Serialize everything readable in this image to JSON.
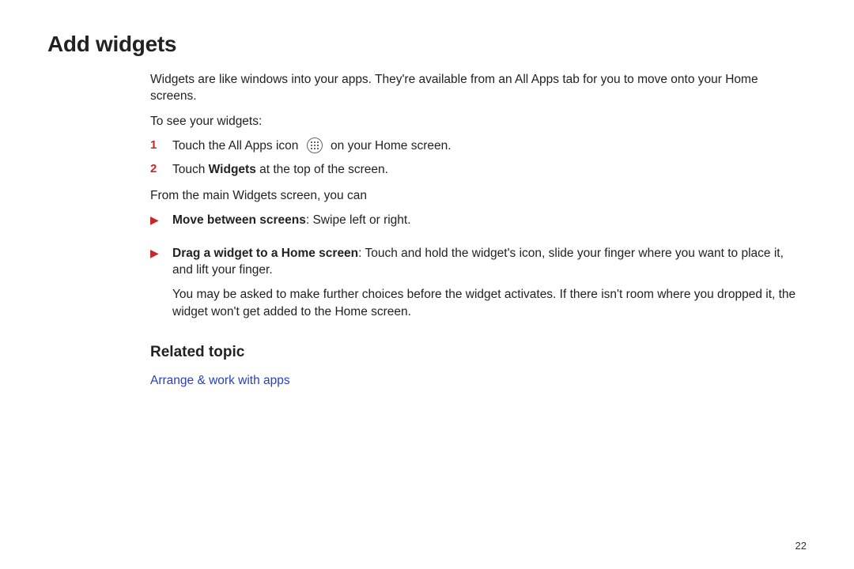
{
  "title": "Add widgets",
  "intro": "Widgets are like windows into your apps. They're available from an All Apps tab for you to move onto your Home screens.",
  "to_see_lead": "To see your widgets:",
  "steps": [
    {
      "num": "1",
      "before_icon": "Touch the All Apps icon ",
      "after_icon": " on your Home screen."
    },
    {
      "num": "2",
      "before_bold": "Touch ",
      "bold": "Widgets",
      "after_bold": " at the top of the screen."
    }
  ],
  "from_main_lead": "From the main Widgets screen, you can",
  "bullets": [
    {
      "bold": "Move between screens",
      "rest": ": Swipe left or right."
    },
    {
      "bold": "Drag a widget to a Home screen",
      "rest": ": Touch and hold the widget's icon, slide your finger where you want to place it, and lift your finger.",
      "extra": "You may be asked to make further choices before the widget activates. If there isn't room where you dropped it, the widget won't get added to the Home screen."
    }
  ],
  "related_heading": "Related topic",
  "related_link": "Arrange & work with apps",
  "page_number": "22"
}
